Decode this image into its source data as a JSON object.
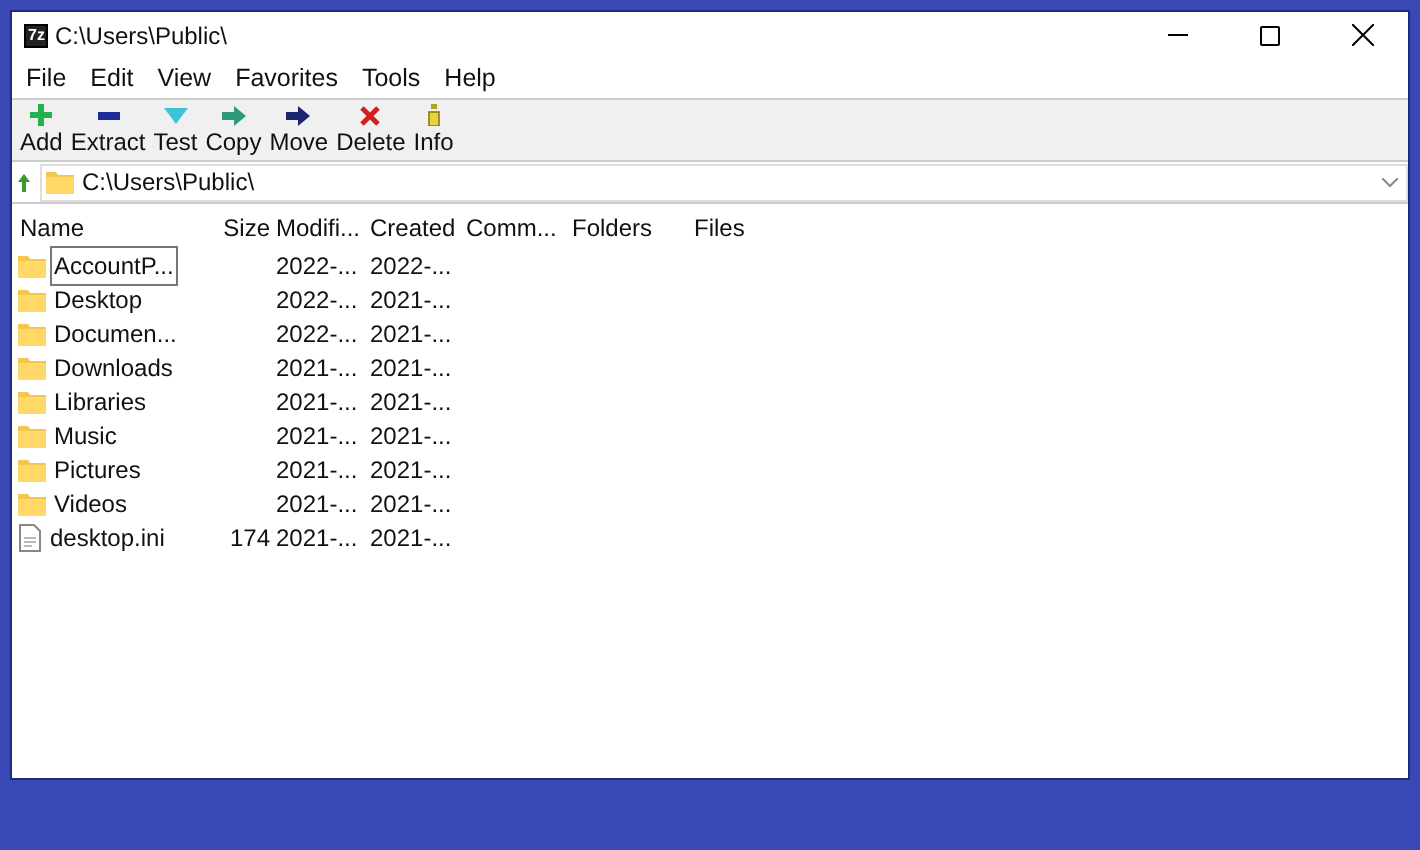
{
  "window": {
    "logo": "7z",
    "title": "C:\\Users\\Public\\"
  },
  "menu": [
    "File",
    "Edit",
    "View",
    "Favorites",
    "Tools",
    "Help"
  ],
  "toolbar": [
    {
      "label": "Add",
      "kind": "add"
    },
    {
      "label": "Extract",
      "kind": "extract"
    },
    {
      "label": "Test",
      "kind": "test"
    },
    {
      "label": "Copy",
      "kind": "copy"
    },
    {
      "label": "Move",
      "kind": "move"
    },
    {
      "label": "Delete",
      "kind": "delete"
    },
    {
      "label": "Info",
      "kind": "info"
    }
  ],
  "address": {
    "value": "C:\\Users\\Public\\"
  },
  "table": {
    "columns": [
      "Name",
      "Size",
      "Modifi...",
      "Created",
      "Comm...",
      "Folders",
      "Files"
    ],
    "rows": [
      {
        "kind": "folder",
        "name": "AccountP...",
        "modified": "2022-...",
        "created": "2022-...",
        "focused": true
      },
      {
        "kind": "folder",
        "name": "Desktop",
        "modified": "2022-...",
        "created": "2021-...",
        "focused": false
      },
      {
        "kind": "folder",
        "name": "Documen...",
        "modified": "2022-...",
        "created": "2021-...",
        "focused": false
      },
      {
        "kind": "folder",
        "name": "Downloads",
        "modified": "2021-...",
        "created": "2021-...",
        "focused": false
      },
      {
        "kind": "folder",
        "name": "Libraries",
        "modified": "2021-...",
        "created": "2021-...",
        "focused": false
      },
      {
        "kind": "folder",
        "name": "Music",
        "modified": "2021-...",
        "created": "2021-...",
        "focused": false
      },
      {
        "kind": "folder",
        "name": "Pictures",
        "modified": "2021-...",
        "created": "2021-...",
        "focused": false
      },
      {
        "kind": "folder",
        "name": "Videos",
        "modified": "2021-...",
        "created": "2021-...",
        "focused": false
      },
      {
        "kind": "file",
        "name": "desktop.ini",
        "size": "174",
        "modified": "2021-...",
        "created": "2021-...",
        "focused": false
      }
    ]
  }
}
